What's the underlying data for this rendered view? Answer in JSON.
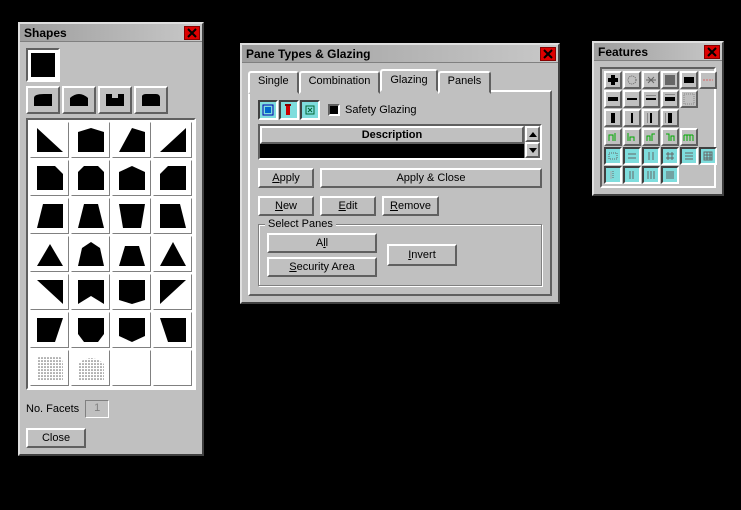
{
  "shapes": {
    "title": "Shapes",
    "facets_label": "No. Facets",
    "facets_value": "1",
    "close_label": "Close"
  },
  "panes": {
    "title": "Pane Types & Glazing",
    "tabs": [
      "Single",
      "Combination",
      "Glazing",
      "Panels"
    ],
    "active_tab": 2,
    "safety_label": "Safety Glazing",
    "list_header": "Description",
    "btn_apply": "Apply",
    "btn_apply_close": "Apply & Close",
    "btn_new": "New",
    "btn_edit": "Edit",
    "btn_remove": "Remove",
    "group_label": "Select Panes",
    "btn_all": "All",
    "btn_secarea": "Security Area",
    "btn_invert": "Invert"
  },
  "features": {
    "title": "Features"
  }
}
